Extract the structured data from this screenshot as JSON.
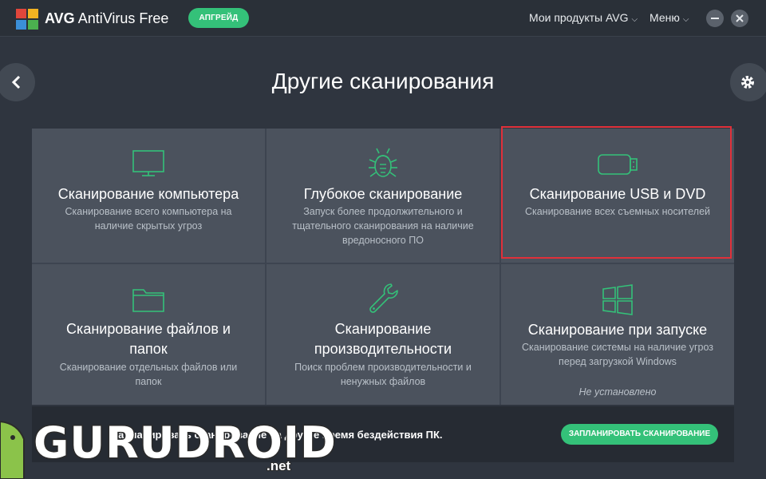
{
  "app": {
    "brand_bold": "AVG",
    "brand_rest": "AntiVirus Free",
    "upgrade_label": "АПГРЕЙД",
    "my_products_label": "Мои продукты AVG",
    "menu_label": "Меню",
    "minimize_icon": "minimize-icon",
    "close_icon": "close-icon"
  },
  "nav": {
    "back_icon": "chevron-left-icon",
    "settings_icon": "gear-icon"
  },
  "page": {
    "title": "Другие сканирования"
  },
  "tiles": [
    {
      "icon": "monitor-icon",
      "title": "Сканирование компьютера",
      "desc_lines": [
        "Сканирование всего компьютера на",
        "наличие скрытых угроз"
      ]
    },
    {
      "icon": "bug-icon",
      "title": "Глубокое сканирование",
      "desc_lines": [
        "Запуск более продолжительного и",
        "тщательного сканирования на наличие",
        "вредоносного ПО"
      ]
    },
    {
      "icon": "usb-drive-icon",
      "title": "Сканирование USB и DVD",
      "desc_lines": [
        "Сканирование всех съемных носителей"
      ]
    },
    {
      "icon": "folder-icon",
      "title_lines": [
        "Сканирование файлов и",
        "папок"
      ],
      "desc_lines": [
        "Сканирование отдельных файлов или",
        "папок"
      ]
    },
    {
      "icon": "wrench-icon",
      "title_lines": [
        "Сканирование",
        "производительности"
      ],
      "desc_lines": [
        "Поиск проблем производительности и",
        "ненужных файлов"
      ]
    },
    {
      "icon": "windows-logo-icon",
      "title": "Сканирование при запуске",
      "desc_lines": [
        "Сканирование системы на наличие угроз",
        "перед загрузкой Windows"
      ],
      "note": "Не установлено"
    }
  ],
  "bottom": {
    "schedule_text": "Запланировать сканирование на другое время бездействия ПК.",
    "schedule_button": "ЗАПЛАНИРОВАТЬ СКАНИРОВАНИЕ"
  },
  "watermark": {
    "text": "GURUDROID",
    "suffix": ".net"
  },
  "colors": {
    "accent": "#34c179",
    "background": "#2f353f",
    "tile": "#4b525d",
    "highlight": "#e0303a"
  }
}
